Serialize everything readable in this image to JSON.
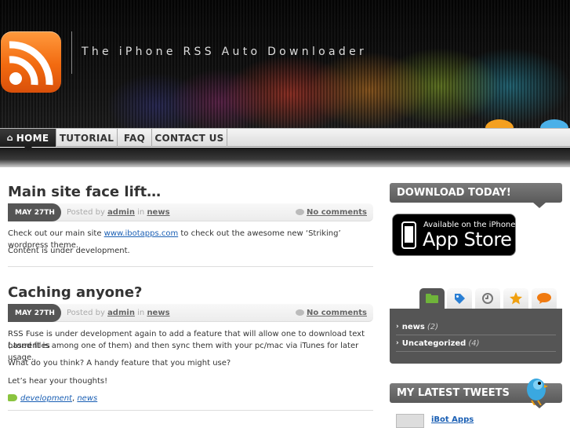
{
  "header": {
    "site_title": "The iPhone RSS Auto Downloader",
    "logo_icon": "rss-icon"
  },
  "nav": {
    "items": [
      {
        "label": "HOME",
        "icon": "home-icon",
        "active": true
      },
      {
        "label": "TUTORIAL"
      },
      {
        "label": "FAQ"
      },
      {
        "label": "CONTACT US"
      }
    ]
  },
  "posts": [
    {
      "title": "Main site face lift…",
      "date": "MAY 27TH",
      "posted_by": "Posted by",
      "author": "admin",
      "in": "in",
      "category": "news",
      "comments": "No comments",
      "paragraphs": [
        {
          "before": "Check out our main site ",
          "link": "www.ibotapps.com",
          "after": " to check out the awesome new ‘Striking’ wordpress theme."
        },
        {
          "before": "Content is under development.",
          "link": "",
          "after": ""
        }
      ]
    },
    {
      "title": "Caching anyone?",
      "date": "MAY 27TH",
      "posted_by": "Posted by",
      "author": "admin",
      "in": "in",
      "category": "news",
      "comments": "No comments",
      "paragraphs": [
        {
          "line1": "RSS Fuse is under development again to add a feature that will allow one to download text based files",
          "line2": "(.torrent is among one of them) and then sync them with your pc/mac via iTunes for later usage."
        },
        {
          "text": "What do you think? A handy feature that you might use?"
        },
        {
          "text": "Let’s hear your thoughts!"
        }
      ],
      "tags": [
        "development",
        "news"
      ],
      "tag_separator": ","
    }
  ],
  "sidebar": {
    "download_heading": "DOWNLOAD TODAY!",
    "appstore_small": "Available on the iPhone",
    "appstore_big": "App Store",
    "tabs": [
      {
        "icon": "folder-icon",
        "color": "#6fb43a"
      },
      {
        "icon": "tag-icon",
        "color": "#2a7fd4"
      },
      {
        "icon": "clock-icon",
        "color": "#777777"
      },
      {
        "icon": "star-icon",
        "color": "#f0a010"
      },
      {
        "icon": "comment-icon",
        "color": "#f07a10"
      }
    ],
    "categories": [
      {
        "name": "news",
        "count": "(2)"
      },
      {
        "name": "Uncategorized",
        "count": "(4)"
      }
    ],
    "tweets_heading": "MY LATEST TWEETS",
    "tweet_author": "iBot Apps"
  },
  "colors": {
    "accent_link": "#1a5fb4",
    "rss_orange": "#f26a10",
    "dark_gray": "#555555"
  }
}
